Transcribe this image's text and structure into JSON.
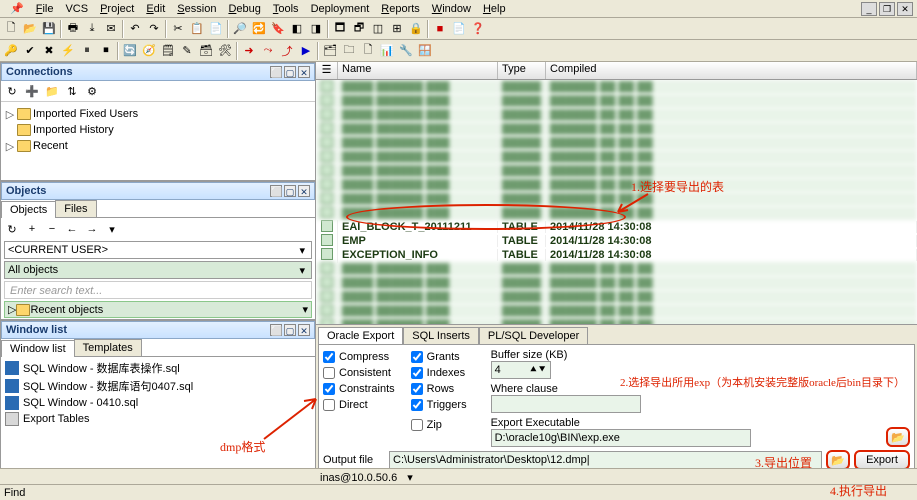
{
  "menubar": {
    "items": [
      "File",
      "VCS",
      "Project",
      "Edit",
      "Session",
      "Debug",
      "Tools",
      "Deployment",
      "Reports",
      "Window",
      "Help"
    ]
  },
  "panes": {
    "connections": {
      "title": "Connections"
    },
    "objects": {
      "title": "Objects"
    },
    "windowlist": {
      "title": "Window list"
    }
  },
  "conn_tree": {
    "items": [
      {
        "label": "Imported Fixed Users"
      },
      {
        "label": "Imported History"
      },
      {
        "label": "Recent"
      }
    ]
  },
  "objects_tabs": {
    "a": "Objects",
    "b": "Files"
  },
  "obj_combo": {
    "user": "<CURRENT USER>",
    "filter": "All objects",
    "search_ph": "Enter search text...",
    "recent": "Recent objects"
  },
  "winlist_tabs": {
    "a": "Window list",
    "b": "Templates"
  },
  "winlist_items": [
    {
      "label": "SQL Window - 数据库表操作.sql"
    },
    {
      "label": "SQL Window - 数据库语句0407.sql"
    },
    {
      "label": "SQL Window - 0410.sql"
    },
    {
      "label": "Export Tables"
    }
  ],
  "grid": {
    "headers": {
      "icon": "",
      "name": "Name",
      "type": "Type",
      "compiled": "Compiled"
    },
    "rows_pre": 10,
    "hl": [
      {
        "name": "EAI_BLOCK_T_20111211",
        "type": "TABLE",
        "compiled": "2014/11/28 14:30:08"
      },
      {
        "name": "EMP",
        "type": "TABLE",
        "compiled": "2014/11/28 14:30:08"
      },
      {
        "name": "EXCEPTION_INFO",
        "type": "TABLE",
        "compiled": "2014/11/28 14:30:08"
      }
    ],
    "rows_post": 8
  },
  "export": {
    "tabs": {
      "a": "Oracle Export",
      "b": "SQL Inserts",
      "c": "PL/SQL Developer"
    },
    "checks": {
      "compress": "Compress",
      "consistent": "Consistent",
      "constraints": "Constraints",
      "direct": "Direct",
      "grants": "Grants",
      "indexes": "Indexes",
      "rows": "Rows",
      "triggers": "Triggers",
      "zip": "Zip"
    },
    "labels": {
      "buffer": "Buffer size (KB)",
      "buffer_val": "4",
      "where": "Where clause",
      "where_val": "",
      "exe": "Export Executable",
      "exe_val": "D:\\oracle10g\\BIN\\exp.exe",
      "outfile": "Output file",
      "outfile_val": "C:\\Users\\Administrator\\Desktop\\12.dmp|",
      "export_btn": "Export"
    }
  },
  "status": {
    "conn": "inas@10.0.50.6",
    "find": "Find"
  },
  "annotations": {
    "a1": "1.选择要导出的表",
    "dmp": "dmp格式",
    "a2": "2.选择导出所用exp（为本机安装完整版oracle后bin目录下）",
    "a3": "3.导出位置",
    "a4": "4.执行导出"
  },
  "icons": {
    "glyphs": [
      "🗋",
      "📂",
      "💾",
      "🖶",
      "✂",
      "📋",
      "📄",
      "↶",
      "↷",
      "🔍",
      "▶",
      "⏸",
      "⏹",
      "⚙",
      "❓",
      "◧",
      "◨",
      "◩",
      "⟳",
      "⤓",
      "⤒",
      "★",
      "✎",
      "➡",
      "⬅",
      "🗂",
      "🗔",
      "🗖",
      "📦",
      "🗑",
      "🔒",
      "🔓"
    ]
  }
}
